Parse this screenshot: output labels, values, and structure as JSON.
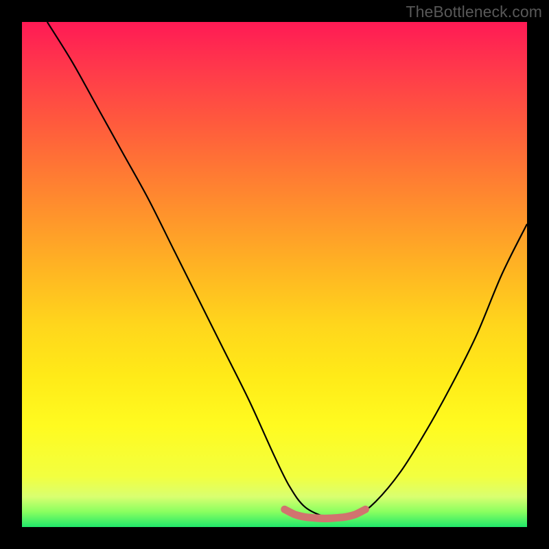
{
  "watermark": "TheBottleneck.com",
  "chart_data": {
    "type": "line",
    "title": "",
    "xlabel": "",
    "ylabel": "",
    "xlim": [
      0,
      100
    ],
    "ylim": [
      0,
      100
    ],
    "series": [
      {
        "name": "main-curve",
        "x": [
          5,
          10,
          15,
          20,
          25,
          30,
          35,
          40,
          45,
          50,
          53,
          56,
          60,
          63,
          66,
          70,
          75,
          80,
          85,
          90,
          95,
          100
        ],
        "y": [
          100,
          92,
          83,
          74,
          65,
          55,
          45,
          35,
          25,
          14,
          8,
          4,
          2,
          1.5,
          2,
          5,
          11,
          19,
          28,
          38,
          50,
          60
        ]
      },
      {
        "name": "bottom-accent",
        "x": [
          52,
          54,
          56,
          58,
          60,
          62,
          64,
          66,
          68
        ],
        "y": [
          3.5,
          2.5,
          2.0,
          1.8,
          1.7,
          1.8,
          2.0,
          2.5,
          3.5
        ]
      }
    ],
    "colors": {
      "gradient_top": "#ff1a55",
      "gradient_mid": "#ffe030",
      "gradient_bottom": "#20e86a",
      "curve": "#000000",
      "accent": "#d1736f"
    }
  }
}
